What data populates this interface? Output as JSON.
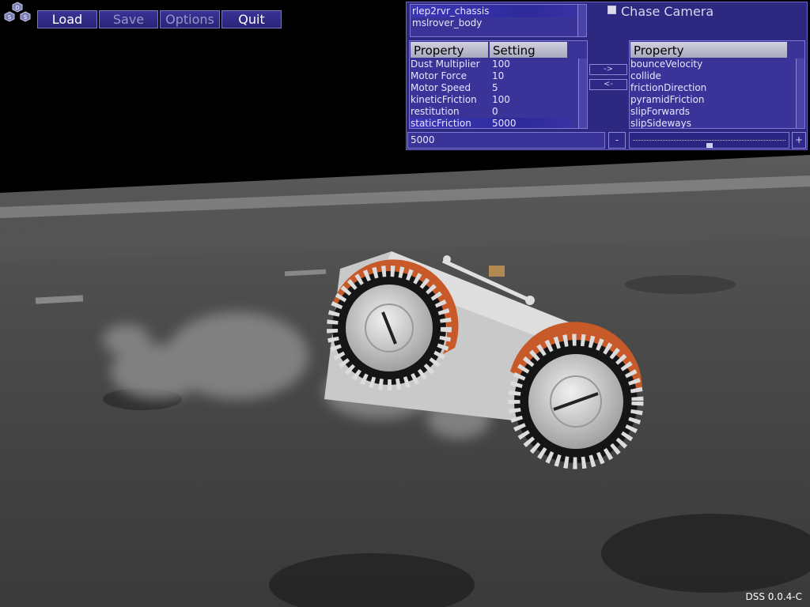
{
  "toolbar": {
    "load_label": "Load",
    "save_label": "Save",
    "options_label": "Options",
    "quit_label": "Quit"
  },
  "logo": {
    "top": "D",
    "left": "S",
    "right": "S"
  },
  "objects": {
    "items": [
      "rlep2rvr_chassis",
      "mslrover_body"
    ],
    "selected_index": 0
  },
  "chase_camera": {
    "label": "Chase Camera",
    "checked": false
  },
  "settings_table": {
    "headers": [
      "Property",
      "Setting"
    ],
    "rows": [
      {
        "property": "Dust Multiplier",
        "setting": "100"
      },
      {
        "property": "Motor Force",
        "setting": "10"
      },
      {
        "property": "Motor Speed",
        "setting": "5"
      },
      {
        "property": "kineticFriction",
        "setting": "100"
      },
      {
        "property": "restitution",
        "setting": "0"
      },
      {
        "property": "staticFriction",
        "setting": "5000"
      }
    ],
    "selected_index": 5
  },
  "move_buttons": {
    "add": "->",
    "remove": "<-"
  },
  "available_properties": {
    "header": "Property",
    "items": [
      "bounceVelocity",
      "collide",
      "frictionDirection",
      "pyramidFriction",
      "slipForwards",
      "slipSideways"
    ]
  },
  "value_field": {
    "value": "5000"
  },
  "slider": {
    "minus": "-",
    "plus": "+",
    "level": 0.5
  },
  "version": "DSS 0.0.4-C",
  "colors": {
    "panel": "#2d2880",
    "accent": "#3c37b8",
    "wheel_fender": "#c75a28"
  }
}
